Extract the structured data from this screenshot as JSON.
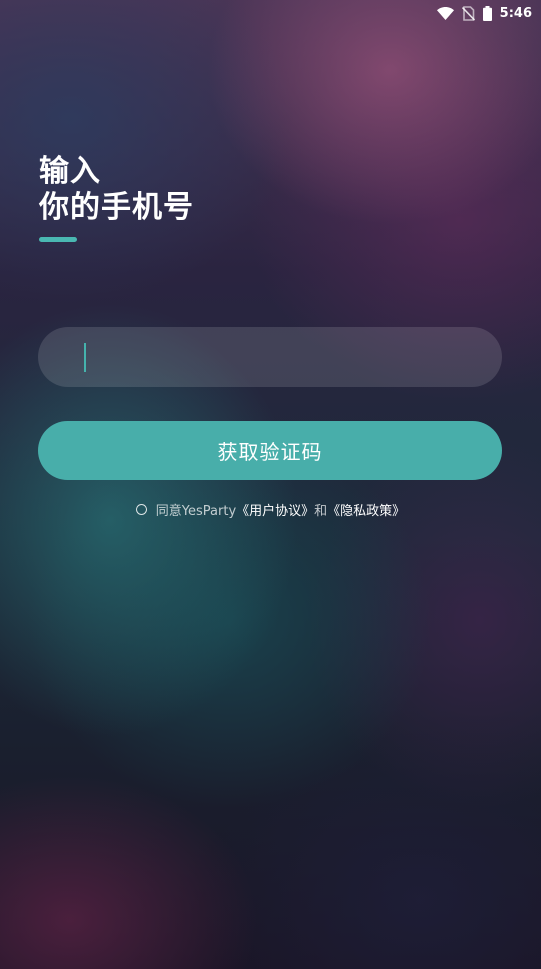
{
  "status_bar": {
    "time": "5:46",
    "icons": [
      "wifi-icon",
      "no-sim-icon",
      "battery-icon"
    ]
  },
  "heading": {
    "line1": "输入",
    "line2": "你的手机号"
  },
  "phone_input": {
    "value": "",
    "placeholder": ""
  },
  "get_code_button": {
    "label": "获取验证码"
  },
  "agreement": {
    "prefix": "同意YesParty",
    "user_agreement": "《用户协议》",
    "conjunction": "和",
    "privacy_policy": "《隐私政策》"
  },
  "colors": {
    "accent": "#48aeaa",
    "caret": "#45b3ad"
  }
}
